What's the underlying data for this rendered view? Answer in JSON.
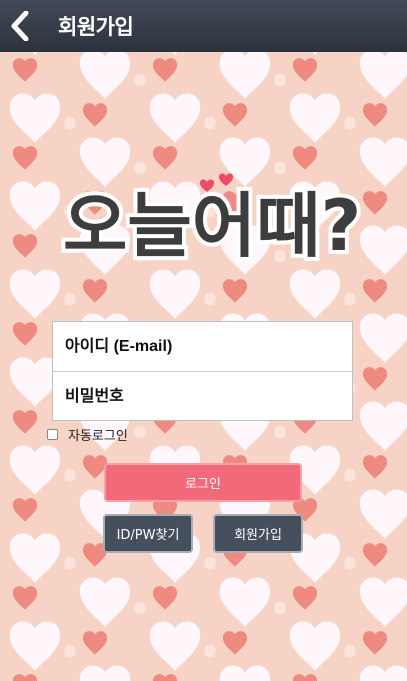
{
  "header": {
    "title": "회원가입",
    "back_icon": "chevron-left-icon"
  },
  "logo": {
    "text": "오늘어때?"
  },
  "login": {
    "id_placeholder": "아이디 (E-mail)",
    "pw_placeholder": "비밀번호",
    "auto_login_label": "자동로그인",
    "auto_login_checked": false,
    "login_button": "로그인",
    "find_button": "ID/PW찾기",
    "join_button": "회원가입"
  },
  "colors": {
    "header": "#2c323d",
    "background": "#f7d3c6",
    "accent_pink": "#f26a79",
    "dark_button": "#464f5e"
  }
}
